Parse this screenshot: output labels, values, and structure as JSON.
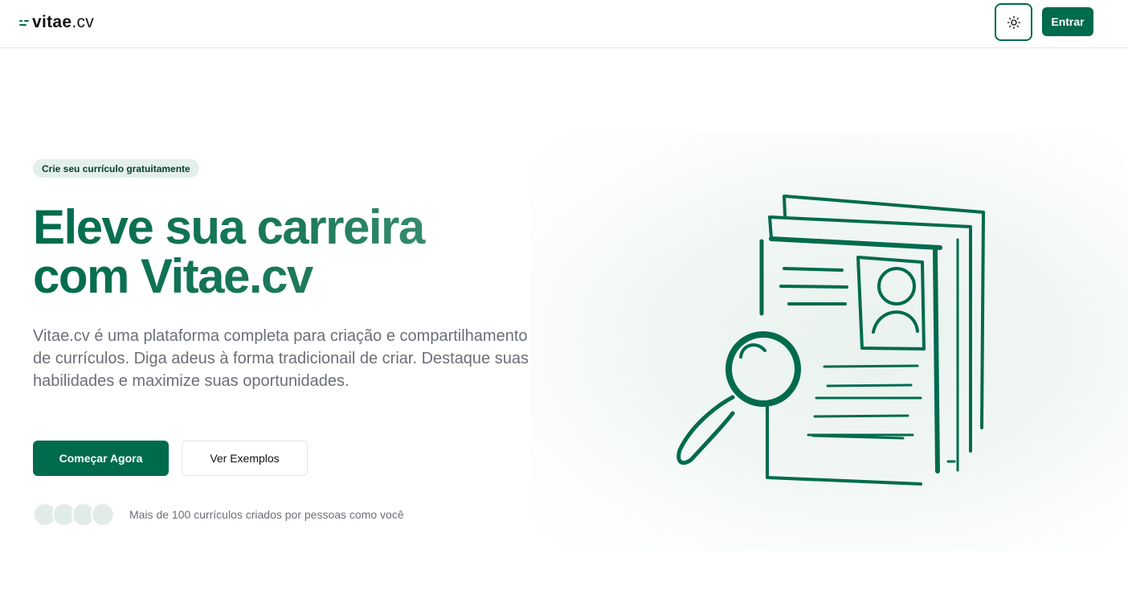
{
  "header": {
    "logo": {
      "name": "vitae",
      "tld": ".cv"
    },
    "theme_toggle_icon": "sun-icon",
    "login_label": "Entrar"
  },
  "hero": {
    "badge": "Crie seu currículo gratuitamente",
    "headline_line1": "Eleve sua carreira",
    "headline_line2": "com Vitae.cv",
    "description": "Vitae.cv é uma plataforma completa para criação e compartilhamento de currículos. Diga adeus à forma tradicionail de criar. Destaque suas habilidades e maximize suas oportunidades.",
    "primary_cta": "Começar Agora",
    "secondary_cta": "Ver Exemplos",
    "social_proof": "Mais de 100 currículos criados por pessoas como você",
    "illustration_icon": "resume-magnifier-illustration"
  },
  "colors": {
    "brand": "#006b4c",
    "badge_bg": "#e3efea",
    "muted_text": "#6b6f76"
  }
}
